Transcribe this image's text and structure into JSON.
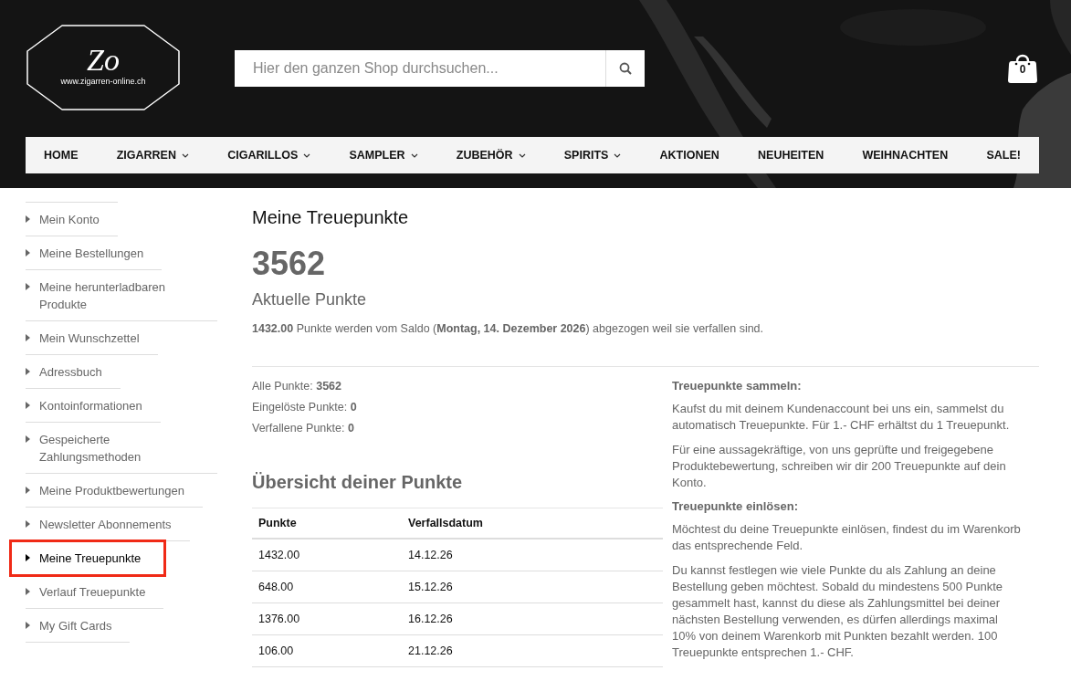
{
  "header": {
    "logo": {
      "mark": "Zo",
      "url": "www.zigarren-online.ch"
    },
    "search": {
      "placeholder": "Hier den ganzen Shop durchsuchen..."
    },
    "cart": {
      "count": "0"
    }
  },
  "nav": [
    {
      "label": "HOME",
      "dropdown": false
    },
    {
      "label": "ZIGARREN",
      "dropdown": true
    },
    {
      "label": "CIGARILLOS",
      "dropdown": true
    },
    {
      "label": "SAMPLER",
      "dropdown": true
    },
    {
      "label": "ZUBEHÖR",
      "dropdown": true
    },
    {
      "label": "SPIRITS",
      "dropdown": true
    },
    {
      "label": "AKTIONEN",
      "dropdown": false
    },
    {
      "label": "NEUHEITEN",
      "dropdown": false
    },
    {
      "label": "WEIHNACHTEN",
      "dropdown": false
    },
    {
      "label": "SALE!",
      "dropdown": false
    }
  ],
  "sidebar": {
    "items": [
      {
        "label": "Mein Konto",
        "selected": false
      },
      {
        "label": "Meine Bestellungen",
        "selected": false
      },
      {
        "label": "Meine herunterladbaren Produkte",
        "selected": false
      },
      {
        "label": "Mein Wunschzettel",
        "selected": false
      },
      {
        "label": "Adressbuch",
        "selected": false
      },
      {
        "label": "Kontoinformationen",
        "selected": false
      },
      {
        "label": "Gespeicherte Zahlungsmethoden",
        "selected": false
      },
      {
        "label": "Meine Produktbewertungen",
        "selected": false
      },
      {
        "label": "Newsletter Abonnements",
        "selected": false
      },
      {
        "label": "Meine Treuepunkte",
        "selected": true
      },
      {
        "label": "Verlauf Treuepunkte",
        "selected": false
      },
      {
        "label": "My Gift Cards",
        "selected": false
      }
    ]
  },
  "main": {
    "title": "Meine Treuepunkte",
    "points": "3562",
    "points_label": "Aktuelle Punkte",
    "expiry_note": "**1432.00** Punkte werden vom Saldo (**Montag, 14. Dezember 2026**) abgezogen weil sie verfallen sind.",
    "stats": [
      "Alle Punkte: **3562**",
      "Eingelöste Punkte: **0**",
      "Verfallene Punkte: **0**"
    ],
    "overview_title": "Übersicht deiner Punkte",
    "table": {
      "columns": [
        "Punkte",
        "Verfallsdatum"
      ],
      "rows": [
        [
          "1432.00",
          "14.12.26"
        ],
        [
          "648.00",
          "15.12.26"
        ],
        [
          "1376.00",
          "16.12.26"
        ],
        [
          "106.00",
          "21.12.26"
        ]
      ]
    },
    "info": [
      {
        "kind": "heading",
        "text": "Treuepunkte sammeln:"
      },
      {
        "kind": "paragraph",
        "text": "Kaufst du mit deinem Kundenaccount bei uns ein, sammelst du automatisch Treuepunkte. Für 1.- CHF erhältst du 1 Treuepunkt."
      },
      {
        "kind": "paragraph",
        "text": "Für eine aussagekräftige, von uns geprüfte und freigegebene Produktebewertung, schreiben wir dir 200 Treuepunkte auf dein Konto."
      },
      {
        "kind": "heading",
        "text": "Treuepunkte einlösen:"
      },
      {
        "kind": "paragraph",
        "text": "Möchtest du deine Treuepunkte einlösen, findest du im Warenkorb das entsprechende Feld."
      },
      {
        "kind": "paragraph",
        "text": "Du kannst festlegen wie viele Punkte du als Zahlung an deine Bestellung geben möchtest. Sobald du mindestens 500 Punkte gesammelt hast, kannst du diese als Zahlungsmittel bei deiner nächsten Bestellung verwenden, es dürfen allerdings maximal 10% von deinem Warenkorb mit Punkten bezahlt werden. 100 Treuepunkte entsprechen 1.- CHF."
      }
    ]
  }
}
